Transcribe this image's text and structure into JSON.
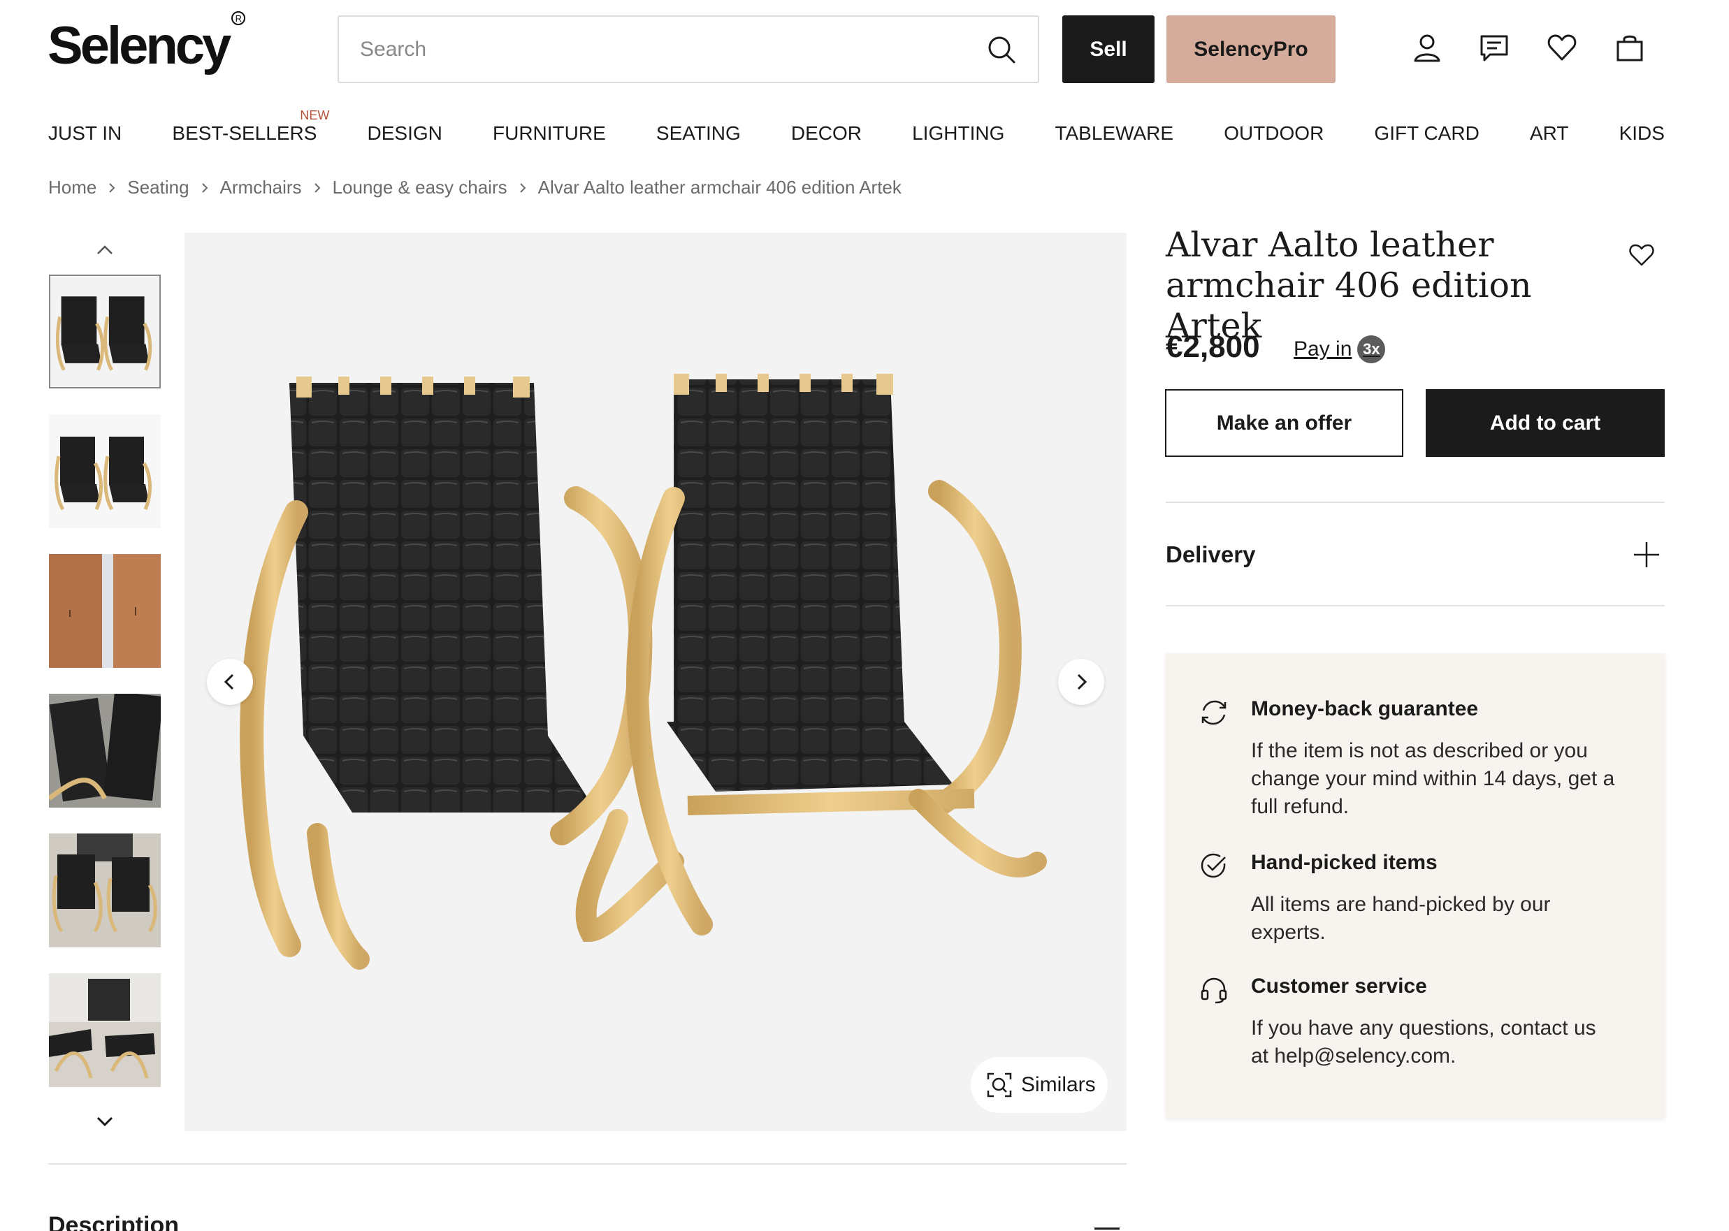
{
  "header": {
    "logo": "Selency",
    "logo_mark": "R",
    "search_placeholder": "Search",
    "sell_label": "Sell",
    "pro_label": "SelencyPro"
  },
  "nav": {
    "items": [
      "JUST IN",
      "BEST-SELLERS",
      "DESIGN",
      "FURNITURE",
      "SEATING",
      "DECOR",
      "LIGHTING",
      "TABLEWARE",
      "OUTDOOR",
      "GIFT CARD",
      "ART",
      "KIDS"
    ],
    "new_badge": "NEW"
  },
  "breadcrumb": [
    "Home",
    "Seating",
    "Armchairs",
    "Lounge & easy chairs",
    "Alvar Aalto leather armchair 406 edition Artek"
  ],
  "gallery": {
    "similars_label": "Similars",
    "thumbnail_count": 6
  },
  "product": {
    "title": "Alvar Aalto leather armchair 406 edition Artek",
    "price": "€2,800",
    "pay_in_label": "Pay in",
    "pay_in_badge": "3x",
    "offer_label": "Make an offer",
    "cart_label": "Add to cart",
    "delivery_label": "Delivery"
  },
  "guarantees": [
    {
      "icon": "refresh-icon",
      "title": "Money-back guarantee",
      "lines": [
        "If the item is not as described or you",
        "change your mind within 14 days, get a",
        "full refund."
      ]
    },
    {
      "icon": "check-circle-icon",
      "title": "Hand-picked items",
      "lines": [
        "All items are hand-picked by our",
        "experts."
      ]
    },
    {
      "icon": "headset-icon",
      "title": "Customer service",
      "lines": [
        "If you have any questions, contact us",
        "at help@selency.com."
      ]
    }
  ],
  "description": {
    "title": "Description"
  },
  "colors": {
    "dark": "#1b1b1b",
    "pro": "#d5ab9c",
    "new_badge": "#b5523a",
    "panel": "#f7f3ef"
  }
}
